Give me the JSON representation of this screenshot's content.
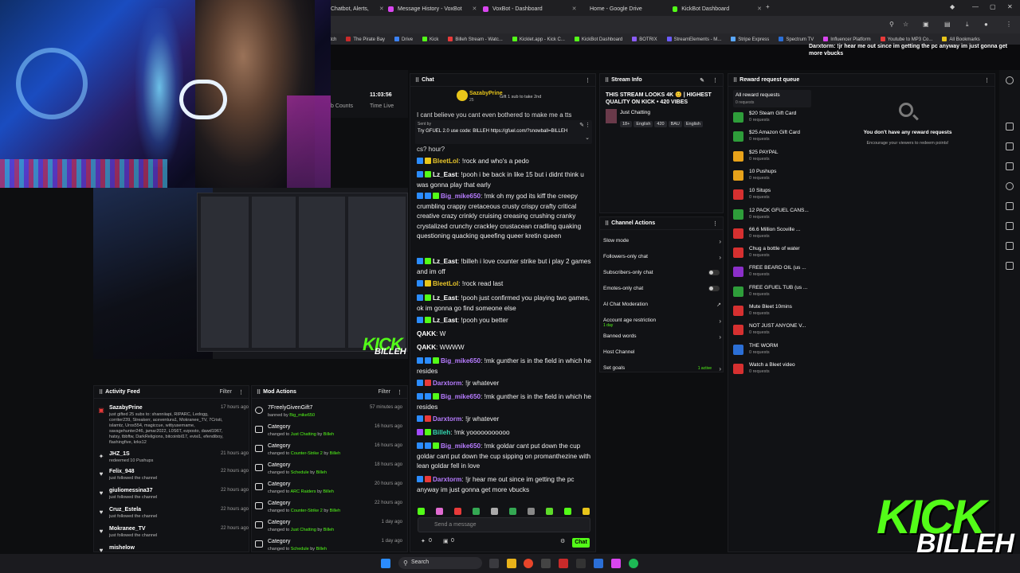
{
  "browser": {
    "tabs": [
      {
        "label": "Chatbot, Alerts,",
        "color": "#8b5cf6"
      },
      {
        "label": "Message History - VoxBot",
        "color": "#d946ef"
      },
      {
        "label": "VoxBot - Dashboard",
        "color": "#d946ef"
      },
      {
        "label": "Home - Google Drive",
        "color": "#3b82f6"
      },
      {
        "label": "KickBot Dashboard",
        "color": "#53fc18"
      }
    ],
    "bookmarks": [
      "itch",
      "The Pirate Bay",
      "Drive",
      "Kick",
      "Billeh Stream - Watc...",
      "Kicklet.app - Kick C...",
      "KickBot Dashboard",
      "BOTRIX",
      "StreamElements - M...",
      "Stripe Express",
      "Spectrum TV",
      "Influencer Platform",
      "Youtube to MP3 Co...",
      "All Bookmarks"
    ],
    "overlay_text": "Darxtorm: !jr hear me out since im getting the pc anyway im just gonna get more vbucks"
  },
  "stream_stats": {
    "counts_label": "b Counts",
    "time_value": "11:03:56",
    "time_label": "Time Live"
  },
  "activity_feed": {
    "title": "Activity Feed",
    "filter": "Filter",
    "items": [
      {
        "name": "SazabyPrine",
        "sub": "just gifted 25 subs to: shanniiapi, RIPARC, Ledogg, corriter239, Streakerr, aceventura1, Mokranee_TV, 7Cristi, islamtz, Uros554, magiccue, wittyusername, savagehunter246, jamar2022, L0S6T, ezposto, dawd1967, hatsy, tbbftw, DarkReligions, bitcoinbil17, evisi1, efendiboy, flashingfive, krks12",
        "time": "17 hours ago",
        "icon": "gift-icon"
      },
      {
        "name": "JHZ_1S",
        "sub": "redeemed 10 Pushups",
        "time": "21 hours ago",
        "icon": "reward-icon"
      },
      {
        "name": "Felix_948",
        "sub": "just followed the channel",
        "time": "22 hours ago",
        "icon": "heart-icon"
      },
      {
        "name": "giuliomessina37",
        "sub": "just followed the channel",
        "time": "22 hours ago",
        "icon": "heart-icon"
      },
      {
        "name": "Cruz_Estela",
        "sub": "just followed the channel",
        "time": "22 hours ago",
        "icon": "heart-icon"
      },
      {
        "name": "Mokranee_TV",
        "sub": "just followed the channel",
        "time": "22 hours ago",
        "icon": "heart-icon"
      },
      {
        "name": "mishelow",
        "sub": "",
        "time": "",
        "icon": "heart-icon"
      }
    ]
  },
  "mod_actions": {
    "title": "Mod Actions",
    "filter": "Filter",
    "items": [
      {
        "title": "7FreelyGivenGift7",
        "sub_pre": "banned by",
        "sub_target": "Big_mike650",
        "sub_by": "",
        "time": "57 minutes ago",
        "icon": "ban-icon"
      },
      {
        "title": "Category",
        "sub_pre": "changed to",
        "sub_target": "Just Chatting",
        "sub_by": "Billeh",
        "time": "16 hours ago",
        "icon": "category-icon"
      },
      {
        "title": "Category",
        "sub_pre": "changed to",
        "sub_target": "Counter-Strike 2",
        "sub_by": "Billeh",
        "time": "16 hours ago",
        "icon": "category-icon"
      },
      {
        "title": "Category",
        "sub_pre": "changed to",
        "sub_target": "Schedule",
        "sub_by": "Billeh",
        "time": "18 hours ago",
        "icon": "category-icon"
      },
      {
        "title": "Category",
        "sub_pre": "changed to",
        "sub_target": "ARC Raiders",
        "sub_by": "Billeh",
        "time": "20 hours ago",
        "icon": "category-icon"
      },
      {
        "title": "Category",
        "sub_pre": "changed to",
        "sub_target": "Counter-Strike 2",
        "sub_by": "Billeh",
        "time": "22 hours ago",
        "icon": "category-icon"
      },
      {
        "title": "Category",
        "sub_pre": "changed to",
        "sub_target": "Just Chatting",
        "sub_by": "Billeh",
        "time": "1 day ago",
        "icon": "category-icon"
      },
      {
        "title": "Category",
        "sub_pre": "changed to",
        "sub_target": "Schedule",
        "sub_by": "Billeh",
        "time": "1 day ago",
        "icon": "category-icon"
      }
    ]
  },
  "chat": {
    "title": "Chat",
    "gifter": "SazabyPrine",
    "gifter_note": "Gift 1 sub to take 2nd",
    "gifter_count": "25",
    "pinned_top": "I cant believe you cant even bothered to make me a tts",
    "pinned_by": "Sent by",
    "pinned_msg": "Try GFUEL 2.0 use code: BILLEH https://gfuel.com/?snowball=BILLEH",
    "pinned_tail": "cs? hour?",
    "messages": [
      {
        "user": "BleetLol",
        "color": "u-yellow",
        "badges": [
          "b-blue",
          "b-yellow"
        ],
        "text": ": !rock and who's a pedo"
      },
      {
        "user": "Lz_East",
        "color": "u-white",
        "badges": [
          "b-blue",
          "b-green"
        ],
        "text": ": !pooh i be back in like 15 but i didnt think u was gonna play that early"
      },
      {
        "user": "Big_mike650",
        "color": "u-violet",
        "badges": [
          "b-blue",
          "b-blue",
          "b-green"
        ],
        "text": ": !mk oh my god its kiff the creepy crumbling crappy cretaceous crusty crispy crafty critical creative crazy crinkly cruising creasing crushing cranky crystalized crunchy crackley crustacean cradling quaking questioning quacking queefing queer kretin queen"
      },
      {
        "user": "Lz_East",
        "color": "u-white",
        "badges": [
          "b-blue",
          "b-green"
        ],
        "text": ": !billeh i love counter strike but i play 2 games and im off"
      },
      {
        "user": "BleetLol",
        "color": "u-yellow",
        "badges": [
          "b-blue",
          "b-yellow"
        ],
        "text": ": !rock read last"
      },
      {
        "user": "Lz_East",
        "color": "u-white",
        "badges": [
          "b-blue",
          "b-green"
        ],
        "text": ": !pooh just confirmed you playing two games, ok im gonna go find someone else"
      },
      {
        "user": "Lz_East",
        "color": "u-white",
        "badges": [
          "b-blue",
          "b-green"
        ],
        "text": ": !pooh you better"
      },
      {
        "user": "QAKK",
        "color": "u-white",
        "badges": [],
        "text": ": W"
      },
      {
        "user": "QAKK",
        "color": "u-white",
        "badges": [],
        "text": ": WWWW"
      },
      {
        "user": "Big_mike650",
        "color": "u-violet",
        "badges": [
          "b-blue",
          "b-blue",
          "b-green"
        ],
        "text": ": !mk gunther is in the field in which he resides"
      },
      {
        "user": "Darxtorm",
        "color": "u-violet",
        "badges": [
          "b-blue",
          "b-red"
        ],
        "text": ": !jr whatever"
      },
      {
        "user": "Big_mike650",
        "color": "u-violet",
        "badges": [
          "b-blue",
          "b-blue",
          "b-green"
        ],
        "text": ": !mk gunther is in the field in which he resides"
      },
      {
        "user": "Darxtorm",
        "color": "u-violet",
        "badges": [
          "b-blue",
          "b-red"
        ],
        "text": ": !jr whatever"
      },
      {
        "user": "Billeh",
        "color": "u-teal",
        "badges": [
          "b-violet",
          "b-green"
        ],
        "text": ": !mk yooooooooooo"
      },
      {
        "user": "Big_mike650",
        "color": "u-violet",
        "badges": [
          "b-blue",
          "b-blue",
          "b-green"
        ],
        "text": ": !mk goldar cant put down the cup goldar cant put down the cup sipping on promanthezine with lean goldar fell in love"
      },
      {
        "user": "Darxtorm",
        "color": "u-violet",
        "badges": [
          "b-blue",
          "b-red"
        ],
        "text": ": !jr hear me out since im getting the pc anyway im just gonna get more vbucks"
      }
    ],
    "input_placeholder": "Send a message",
    "send_label": "Chat",
    "points": "0",
    "gift_count": "0"
  },
  "stream_info": {
    "title": "Stream Info",
    "stream_title": "THIS STREAM LOOKS 4K 😊 | HIGHEST QUALITY ON KICK • 420 VIBES",
    "category": "Just Chatting",
    "tags": [
      "18+",
      "English",
      "420",
      "BAU",
      "English"
    ]
  },
  "channel_actions": {
    "title": "Channel Actions",
    "rows": [
      {
        "label": "Slow mode",
        "control": "chevron",
        "sub": ""
      },
      {
        "label": "Followers-only chat",
        "control": "chevron",
        "sub": ""
      },
      {
        "label": "Subscribers-only chat",
        "control": "toggle",
        "sub": ""
      },
      {
        "label": "Emotes-only chat",
        "control": "toggle",
        "sub": ""
      },
      {
        "label": "AI Chat Moderation",
        "control": "external",
        "sub": ""
      },
      {
        "label": "Account age restriction",
        "control": "chevron",
        "sub": "1 day"
      },
      {
        "label": "Banned words",
        "control": "chevron",
        "sub": ""
      },
      {
        "label": "Host Channel",
        "control": "none",
        "sub": ""
      },
      {
        "label": "Set goals",
        "control": "chevron",
        "sub": "1 active"
      }
    ]
  },
  "rewards": {
    "title": "Reward request queue",
    "all_label": "All reward requests",
    "all_sub": "0 requests",
    "empty_title": "You don't have any reward requests",
    "empty_sub": "Encourage your viewers to redeem points!",
    "items": [
      {
        "name": "$20 Steam Gift Card",
        "sub": "0 requests",
        "color": "#2e9d3a"
      },
      {
        "name": "$25 Amazon Gift Card",
        "sub": "0 requests",
        "color": "#2e9d3a"
      },
      {
        "name": "$25 PAYPAL",
        "sub": "0 requests",
        "color": "#e8a21a"
      },
      {
        "name": "10 Pushups",
        "sub": "0 requests",
        "color": "#e8a21a"
      },
      {
        "name": "10 Situps",
        "sub": "0 requests",
        "color": "#d63030"
      },
      {
        "name": "12 PACK GFUEL CANS...",
        "sub": "0 requests",
        "color": "#2e9d3a"
      },
      {
        "name": "66.6 Million Scoville ...",
        "sub": "0 requests",
        "color": "#d63030"
      },
      {
        "name": "Chug a bottle of water",
        "sub": "0 requests",
        "color": "#d63030"
      },
      {
        "name": "FREE BEARD OIL (us ...",
        "sub": "0 requests",
        "color": "#8b2fc9"
      },
      {
        "name": "FREE GFUEL TUB (us ...",
        "sub": "0 requests",
        "color": "#2e9d3a"
      },
      {
        "name": "Mute Bleet 10mins",
        "sub": "0 requests",
        "color": "#d63030"
      },
      {
        "name": "NOT JUST ANYONE V...",
        "sub": "0 requests",
        "color": "#d63030"
      },
      {
        "name": "THE WORM",
        "sub": "0 requests",
        "color": "#2b6fd6"
      },
      {
        "name": "Watch a Bleet video",
        "sub": "0 requests",
        "color": "#d63030"
      }
    ]
  },
  "branding": {
    "kick": "KICK",
    "billeh": "BILLEH"
  },
  "taskbar": {
    "search": "Search"
  }
}
